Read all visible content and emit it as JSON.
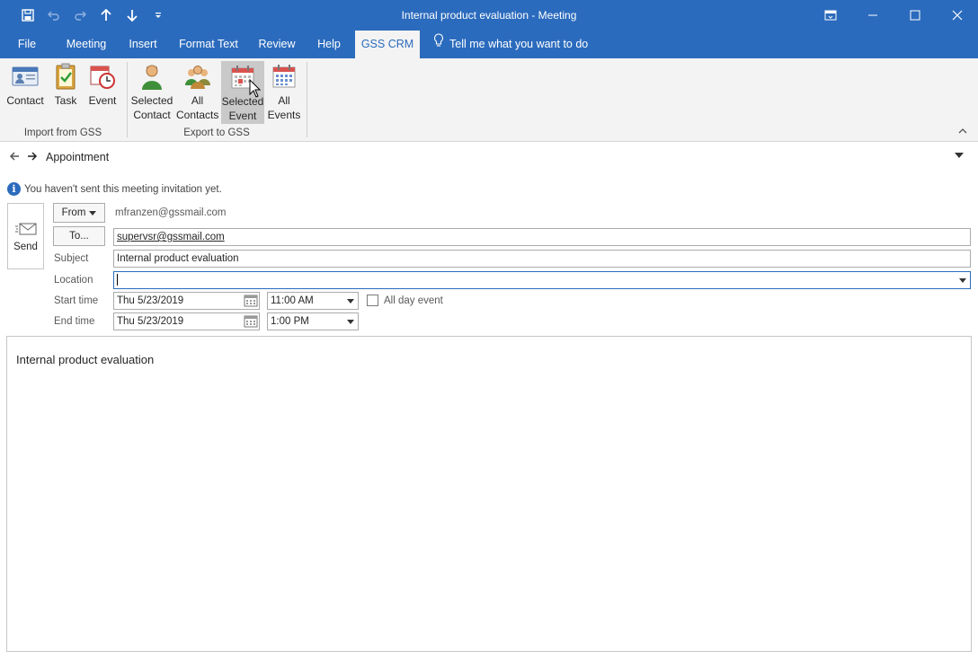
{
  "window": {
    "title": "Internal product evaluation  -  Meeting",
    "controls": [
      "restore-ribbon",
      "minimize",
      "maximize",
      "close"
    ]
  },
  "quick_access": [
    "save-icon",
    "undo-icon",
    "redo-icon",
    "up-arrow-icon",
    "down-arrow-icon",
    "customize-icon"
  ],
  "tabs": [
    {
      "label": "File"
    },
    {
      "label": "Meeting"
    },
    {
      "label": "Insert"
    },
    {
      "label": "Format Text"
    },
    {
      "label": "Review"
    },
    {
      "label": "Help"
    },
    {
      "label": "GSS CRM"
    }
  ],
  "tell_me": "Tell me what you want to do",
  "ribbon": {
    "import_group": {
      "label": "Import from GSS",
      "buttons": [
        {
          "label": "Contact",
          "icon": "contact-card-icon"
        },
        {
          "label": "Task",
          "icon": "task-clipboard-icon"
        },
        {
          "label": "Event",
          "icon": "event-clock-icon"
        }
      ]
    },
    "export_group": {
      "label": "Export to GSS",
      "buttons": [
        {
          "line1": "Selected",
          "line2": "Contact",
          "icon": "person-icon"
        },
        {
          "line1": "All",
          "line2": "Contacts",
          "icon": "people-icon"
        },
        {
          "line1": "Selected",
          "line2": "Event",
          "icon": "calendar-icon"
        },
        {
          "line1": "All",
          "line2": "Events",
          "icon": "calendar-icon"
        }
      ]
    }
  },
  "appointment": {
    "label": "Appointment",
    "info_message": "You haven't sent this meeting invitation yet.",
    "send_label": "Send",
    "from_button": "From",
    "from_value": "mfranzen@gssmail.com",
    "to_button": "To...",
    "to_value": "supervsr@gssmail.com",
    "subject_label": "Subject",
    "subject_value": "Internal product evaluation",
    "location_label": "Location",
    "location_value": "",
    "start_label": "Start time",
    "start_date": "Thu 5/23/2019",
    "start_time": "11:00 AM",
    "all_day_label": "All day event",
    "all_day_checked": false,
    "end_label": "End time",
    "end_date": "Thu 5/23/2019",
    "end_time": "1:00 PM",
    "body_text": "Internal product evaluation"
  },
  "colors": {
    "title_bar": "#2b6bbd",
    "ribbon_bg": "#f3f3f3",
    "hover": "#c9c9c9"
  }
}
